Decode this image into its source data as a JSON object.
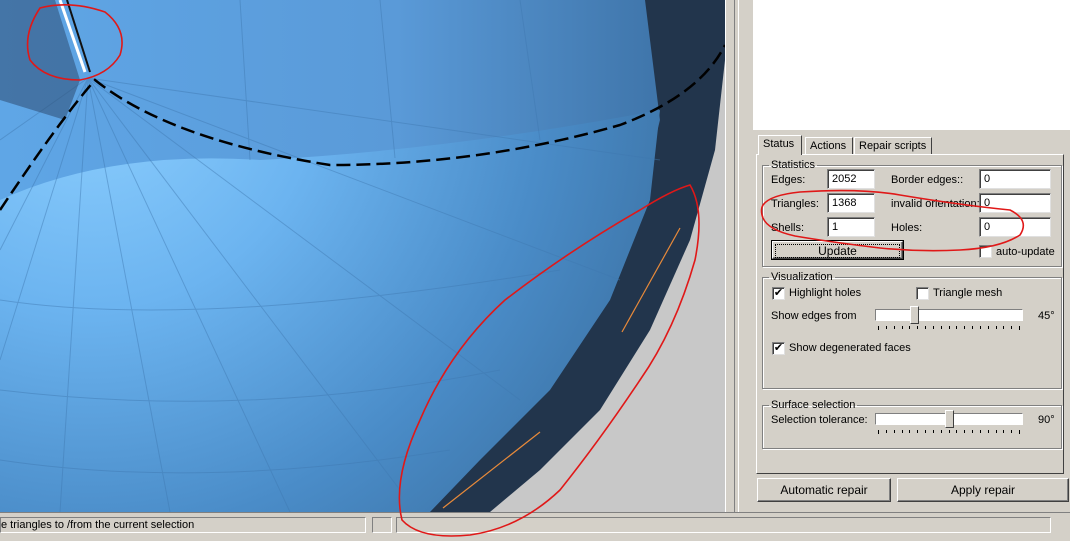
{
  "tabs": [
    {
      "label": "Status",
      "active": true
    },
    {
      "label": "Actions",
      "active": false
    },
    {
      "label": "Repair scripts",
      "active": false
    }
  ],
  "statistics": {
    "title": "Statistics",
    "edges_label": "Edges:",
    "edges_value": "2052",
    "triangles_label": "Triangles:",
    "triangles_value": "1368",
    "shells_label": "Shells:",
    "shells_value": "1",
    "border_edges_label": "Border edges::",
    "border_edges_value": "0",
    "invalid_orientation_label": "invalid orientation:",
    "invalid_orientation_value": "0",
    "holes_label": "Holes:",
    "holes_value": "0",
    "update_label": "Update",
    "auto_update_label": "auto-update",
    "auto_update_checked": false
  },
  "visualization": {
    "title": "Visualization",
    "highlight_holes_label": "Highlight holes",
    "highlight_holes_checked": true,
    "triangle_mesh_label": "Triangle mesh",
    "triangle_mesh_checked": false,
    "show_edges_label": "Show edges from",
    "show_edges_value": "45°",
    "show_edges_fraction": 0.25,
    "show_degenerated_label": "Show degenerated faces",
    "show_degenerated_checked": true
  },
  "surface_selection": {
    "title": "Surface selection",
    "tolerance_label": "Selection tolerance:",
    "tolerance_value": "90°",
    "tolerance_fraction": 0.5
  },
  "buttons": {
    "automatic_repair": "Automatic repair",
    "apply_repair": "Apply repair"
  },
  "statusbar": {
    "message": "e triangles to /from the current selection"
  },
  "colors": {
    "mesh_light": "#6fb0ee",
    "mesh_dark": "#22354c",
    "annotation": "#e01818",
    "panel_bg": "#d4d0c8"
  }
}
